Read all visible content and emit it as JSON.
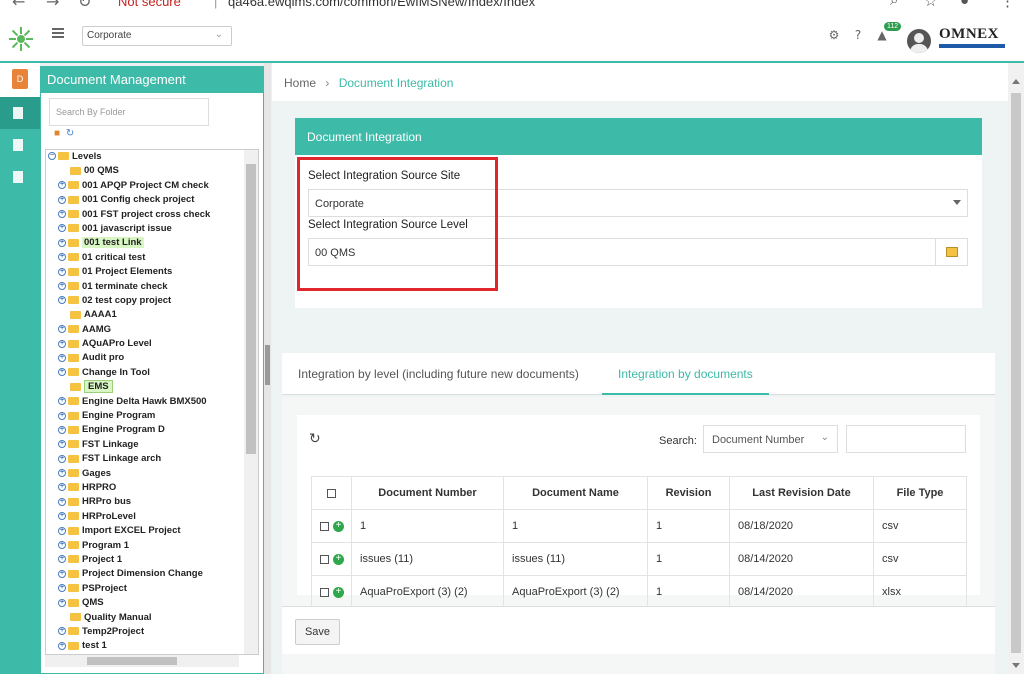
{
  "browser": {
    "security_warning": "Not secure",
    "url": "qa46a.ewqims.com/common/EwIMSNew/Index/Index"
  },
  "header": {
    "site_selected": "Corporate",
    "notification_count": "112",
    "brand": "OMNEX"
  },
  "doc_mgmt": {
    "title": "Document Management",
    "search_placeholder": "Search By Folder",
    "tree": [
      "Levels",
      "00 QMS",
      "001 APQP Project CM check",
      "001 Config check project",
      "001 FST project cross check",
      "001 javascript issue",
      "001 test Link",
      "01 critical test",
      "01 Project Elements",
      "01 terminate check",
      "02 test copy project",
      "AAAA1",
      "AAMG",
      "AQuAPro Level",
      "Audit pro",
      "Change In Tool",
      "EMS",
      "Engine Delta Hawk BMX500",
      "Engine Program",
      "Engine Program D",
      "FST Linkage",
      "FST Linkage arch",
      "Gages",
      "HRPRO",
      "HRPro bus",
      "HRProLevel",
      "Import EXCEL Project",
      "Program 1",
      "Project 1",
      "Project Dimension Change",
      "PSProject",
      "QMS",
      "Quality Manual",
      "Temp2Project",
      "test 1"
    ]
  },
  "breadcrumb": {
    "home": "Home",
    "current": "Document Integration"
  },
  "integration": {
    "title": "Document Integration",
    "site_label": "Select Integration Source Site",
    "site_value": "Corporate",
    "level_label": "Select Integration Source Level",
    "level_value": "00 QMS"
  },
  "tabs": {
    "by_level": "Integration by level (including future new documents)",
    "by_documents": "Integration by documents"
  },
  "grid": {
    "search_label": "Search:",
    "search_by": "Document Number",
    "columns": [
      "Document Number",
      "Document Name",
      "Revision",
      "Last Revision Date",
      "File Type"
    ],
    "rows": [
      [
        "1",
        "1",
        "1",
        "08/18/2020",
        "csv"
      ],
      [
        "issues (11)",
        "issues (11)",
        "1",
        "08/14/2020",
        "csv"
      ],
      [
        "AquaProExport (3) (2)",
        "AquaProExport (3) (2)",
        "1",
        "08/14/2020",
        "xlsx"
      ]
    ]
  },
  "footer": {
    "save_label": "Save"
  },
  "colors": {
    "accent": "#3dbaa8",
    "highlight_box": "#e0272d",
    "add_icon": "#2ea84a"
  }
}
